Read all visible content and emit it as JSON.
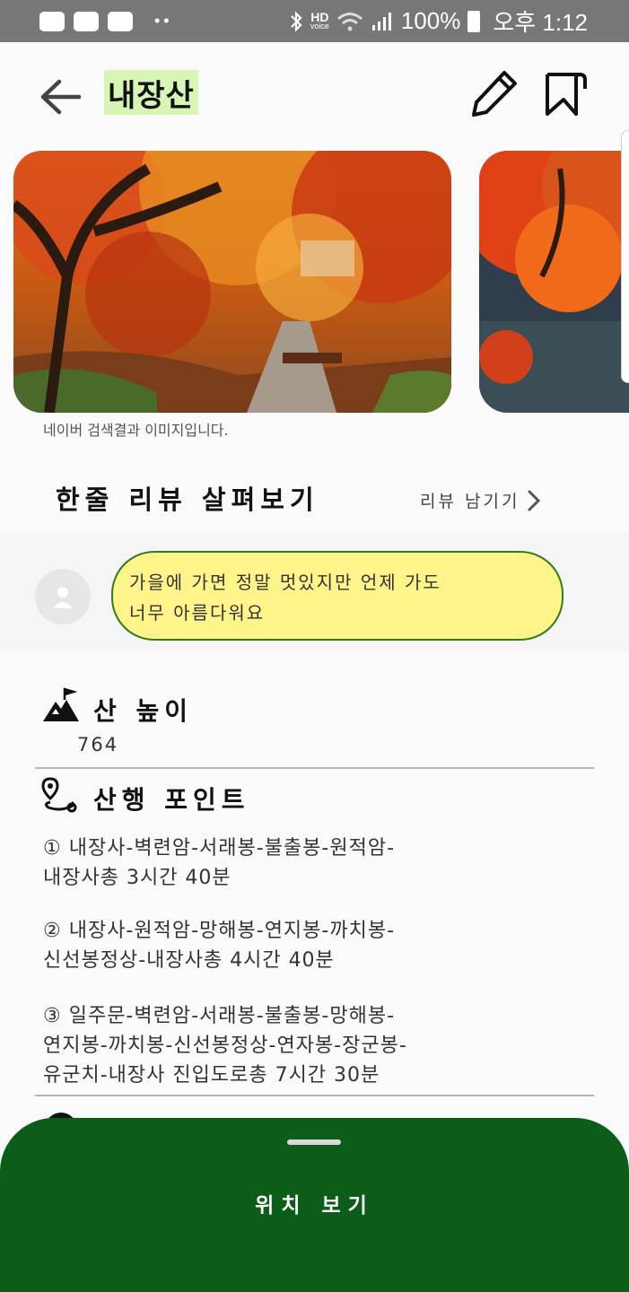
{
  "status_bar": {
    "hd_label": "HD",
    "voice_label": "voice",
    "battery": "100%",
    "time": "오후 1:12",
    "icons": [
      "message-icon",
      "youtube-icon",
      "activity-icon",
      "bluetooth-icon",
      "wifi-icon",
      "signal-icon",
      "battery-icon"
    ]
  },
  "header": {
    "title": "내장산",
    "highlight_color": "#d7f5b5"
  },
  "gallery": {
    "caption": "네이버 검색결과 이미지입니다."
  },
  "reviews": {
    "section_title": "한줄 리뷰 살펴보기",
    "leave_review_label": "리뷰 남기기",
    "items": [
      {
        "line1": "가을에 가면 정말 멋있지만 언제 가도",
        "line2": "너무 아름다워요"
      }
    ],
    "bubble_color": "#fff48a",
    "bubble_border": "#2d7d1d"
  },
  "height": {
    "title": "산 높이",
    "value": "764"
  },
  "points": {
    "title": "산행 포인트",
    "routes": [
      {
        "line1": "① 내장사-벽련암-서래봉-불출봉-원적암-",
        "line2": "내장사총 3시간 40분"
      },
      {
        "line1": "② 내장사-원적암-망해봉-연지봉-까치봉-",
        "line2": "신선봉정상-내장사총 4시간 40분"
      },
      {
        "line1": "③ 일주문-벽련암-서래봉-불출봉-망해봉-",
        "line2": "연지봉-까치봉-신선봉정상-연자봉-장군봉-",
        "line3": "유군치-내장사 진입도로총 7시간 30분"
      }
    ]
  },
  "bottom_sheet": {
    "label": "위치 보기",
    "color": "#0b5d19"
  }
}
